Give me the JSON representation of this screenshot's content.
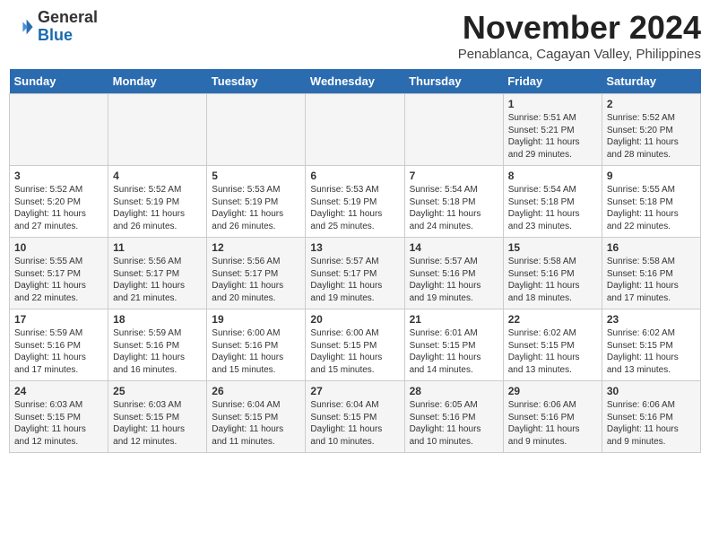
{
  "logo": {
    "general": "General",
    "blue": "Blue"
  },
  "header": {
    "month": "November 2024",
    "location": "Penablanca, Cagayan Valley, Philippines"
  },
  "weekdays": [
    "Sunday",
    "Monday",
    "Tuesday",
    "Wednesday",
    "Thursday",
    "Friday",
    "Saturday"
  ],
  "weeks": [
    [
      {
        "day": "",
        "info": ""
      },
      {
        "day": "",
        "info": ""
      },
      {
        "day": "",
        "info": ""
      },
      {
        "day": "",
        "info": ""
      },
      {
        "day": "",
        "info": ""
      },
      {
        "day": "1",
        "info": "Sunrise: 5:51 AM\nSunset: 5:21 PM\nDaylight: 11 hours and 29 minutes."
      },
      {
        "day": "2",
        "info": "Sunrise: 5:52 AM\nSunset: 5:20 PM\nDaylight: 11 hours and 28 minutes."
      }
    ],
    [
      {
        "day": "3",
        "info": "Sunrise: 5:52 AM\nSunset: 5:20 PM\nDaylight: 11 hours and 27 minutes."
      },
      {
        "day": "4",
        "info": "Sunrise: 5:52 AM\nSunset: 5:19 PM\nDaylight: 11 hours and 26 minutes."
      },
      {
        "day": "5",
        "info": "Sunrise: 5:53 AM\nSunset: 5:19 PM\nDaylight: 11 hours and 26 minutes."
      },
      {
        "day": "6",
        "info": "Sunrise: 5:53 AM\nSunset: 5:19 PM\nDaylight: 11 hours and 25 minutes."
      },
      {
        "day": "7",
        "info": "Sunrise: 5:54 AM\nSunset: 5:18 PM\nDaylight: 11 hours and 24 minutes."
      },
      {
        "day": "8",
        "info": "Sunrise: 5:54 AM\nSunset: 5:18 PM\nDaylight: 11 hours and 23 minutes."
      },
      {
        "day": "9",
        "info": "Sunrise: 5:55 AM\nSunset: 5:18 PM\nDaylight: 11 hours and 22 minutes."
      }
    ],
    [
      {
        "day": "10",
        "info": "Sunrise: 5:55 AM\nSunset: 5:17 PM\nDaylight: 11 hours and 22 minutes."
      },
      {
        "day": "11",
        "info": "Sunrise: 5:56 AM\nSunset: 5:17 PM\nDaylight: 11 hours and 21 minutes."
      },
      {
        "day": "12",
        "info": "Sunrise: 5:56 AM\nSunset: 5:17 PM\nDaylight: 11 hours and 20 minutes."
      },
      {
        "day": "13",
        "info": "Sunrise: 5:57 AM\nSunset: 5:17 PM\nDaylight: 11 hours and 19 minutes."
      },
      {
        "day": "14",
        "info": "Sunrise: 5:57 AM\nSunset: 5:16 PM\nDaylight: 11 hours and 19 minutes."
      },
      {
        "day": "15",
        "info": "Sunrise: 5:58 AM\nSunset: 5:16 PM\nDaylight: 11 hours and 18 minutes."
      },
      {
        "day": "16",
        "info": "Sunrise: 5:58 AM\nSunset: 5:16 PM\nDaylight: 11 hours and 17 minutes."
      }
    ],
    [
      {
        "day": "17",
        "info": "Sunrise: 5:59 AM\nSunset: 5:16 PM\nDaylight: 11 hours and 17 minutes."
      },
      {
        "day": "18",
        "info": "Sunrise: 5:59 AM\nSunset: 5:16 PM\nDaylight: 11 hours and 16 minutes."
      },
      {
        "day": "19",
        "info": "Sunrise: 6:00 AM\nSunset: 5:16 PM\nDaylight: 11 hours and 15 minutes."
      },
      {
        "day": "20",
        "info": "Sunrise: 6:00 AM\nSunset: 5:15 PM\nDaylight: 11 hours and 15 minutes."
      },
      {
        "day": "21",
        "info": "Sunrise: 6:01 AM\nSunset: 5:15 PM\nDaylight: 11 hours and 14 minutes."
      },
      {
        "day": "22",
        "info": "Sunrise: 6:02 AM\nSunset: 5:15 PM\nDaylight: 11 hours and 13 minutes."
      },
      {
        "day": "23",
        "info": "Sunrise: 6:02 AM\nSunset: 5:15 PM\nDaylight: 11 hours and 13 minutes."
      }
    ],
    [
      {
        "day": "24",
        "info": "Sunrise: 6:03 AM\nSunset: 5:15 PM\nDaylight: 11 hours and 12 minutes."
      },
      {
        "day": "25",
        "info": "Sunrise: 6:03 AM\nSunset: 5:15 PM\nDaylight: 11 hours and 12 minutes."
      },
      {
        "day": "26",
        "info": "Sunrise: 6:04 AM\nSunset: 5:15 PM\nDaylight: 11 hours and 11 minutes."
      },
      {
        "day": "27",
        "info": "Sunrise: 6:04 AM\nSunset: 5:15 PM\nDaylight: 11 hours and 10 minutes."
      },
      {
        "day": "28",
        "info": "Sunrise: 6:05 AM\nSunset: 5:16 PM\nDaylight: 11 hours and 10 minutes."
      },
      {
        "day": "29",
        "info": "Sunrise: 6:06 AM\nSunset: 5:16 PM\nDaylight: 11 hours and 9 minutes."
      },
      {
        "day": "30",
        "info": "Sunrise: 6:06 AM\nSunset: 5:16 PM\nDaylight: 11 hours and 9 minutes."
      }
    ]
  ]
}
